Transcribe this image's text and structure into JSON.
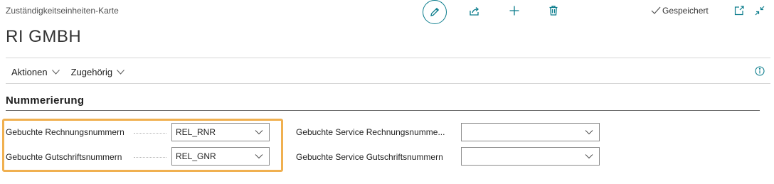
{
  "header": {
    "breadcrumb": "Zuständigkeitseinheiten-Karte",
    "title": "RI GMBH",
    "saved_label": "Gespeichert"
  },
  "toolbar": {
    "icons": [
      "edit-icon",
      "share-icon",
      "plus-icon",
      "trash-icon",
      "open-new-window-icon",
      "collapse-icon"
    ]
  },
  "actionbar": {
    "items": [
      {
        "label": "Aktionen"
      },
      {
        "label": "Zugehörig"
      }
    ]
  },
  "section": {
    "title": "Nummerierung",
    "fields": [
      {
        "label": "Gebuchte Rechnungsnummern",
        "value": "REL_RNR"
      },
      {
        "label": "Gebuchte Gutschriftsnummern",
        "value": "REL_GNR"
      },
      {
        "label": "Gebuchte Service Rechnungsnumme...",
        "value": ""
      },
      {
        "label": "Gebuchte Service Gutschriftsnummern",
        "value": ""
      }
    ]
  },
  "colors": {
    "accent": "#0a7c8c",
    "highlight": "#f0b050"
  }
}
